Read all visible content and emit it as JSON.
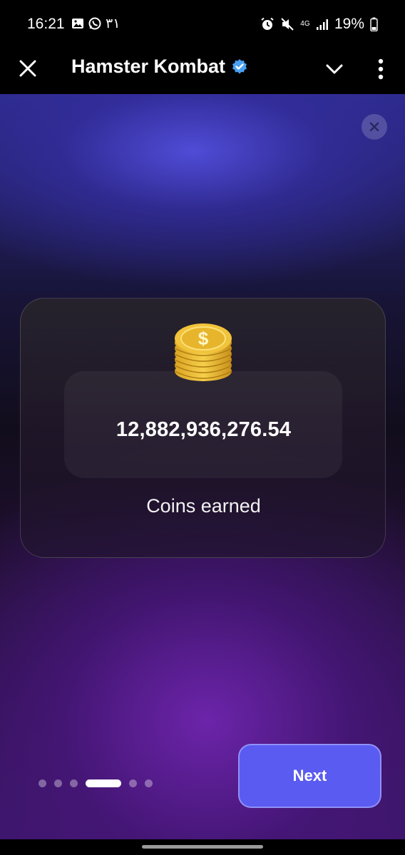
{
  "status_bar": {
    "time": "16:21",
    "arabic_indicator": "٣١",
    "network": "4G",
    "battery": "19%",
    "icons": [
      "gallery-icon",
      "whatsapp-icon",
      "alarm-icon",
      "mute-icon",
      "signal-icon",
      "battery-icon"
    ]
  },
  "app_bar": {
    "title": "Hamster Kombat",
    "icons": [
      "close-icon",
      "verified-badge-icon",
      "chevron-down-icon",
      "more-vertical-icon"
    ]
  },
  "card": {
    "amount": "12,882,936,276.54",
    "caption": "Coins earned",
    "icon": "coin-stack-icon"
  },
  "pagination": {
    "total": 6,
    "current": 4
  },
  "next_button": {
    "label": "Next"
  },
  "colors": {
    "accent": "#5a5bf0",
    "bg_top": "#2c2a8a",
    "bg_bottom": "#3a1668"
  }
}
